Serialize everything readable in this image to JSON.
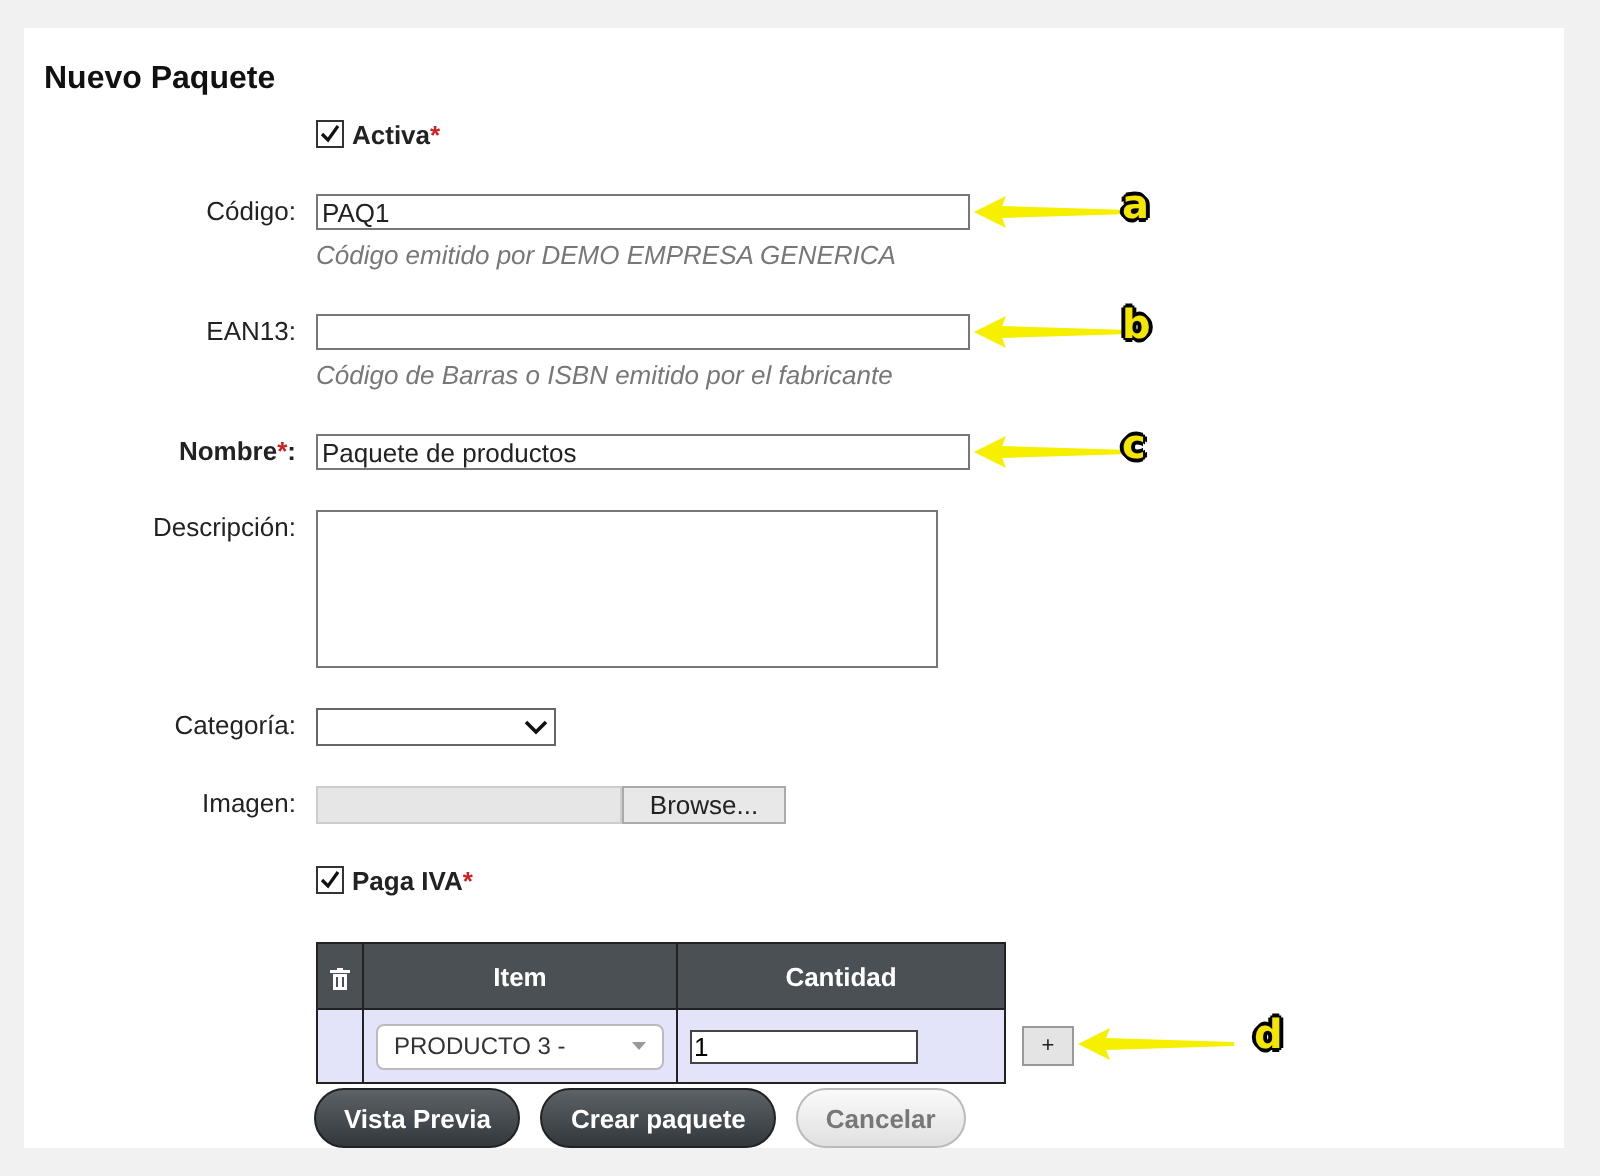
{
  "title": "Nuevo Paquete",
  "fields": [
    {
      "kind": "checkbox",
      "label": "Activa",
      "required_mark": "*",
      "checked": true
    },
    {
      "kind": "text",
      "label": "Código",
      "suffix": ":",
      "value": "PAQ1",
      "hint": "Código emitido por DEMO EMPRESA GENERICA",
      "callout": "a"
    },
    {
      "kind": "text",
      "label": "EAN13",
      "suffix": ":",
      "hint": "Código de Barras o ISBN emitido por el fabricante",
      "callout": "b"
    },
    {
      "kind": "text",
      "label": "Nombre",
      "required_mark": "*",
      "suffix": ":",
      "bold": true,
      "value": "Paquete de productos",
      "callout": "c"
    },
    {
      "kind": "textarea",
      "label": "Descripción",
      "suffix": ":"
    },
    {
      "kind": "select",
      "label": "Categoría",
      "suffix": ":"
    },
    {
      "kind": "file",
      "label": "Imagen",
      "suffix": ":",
      "button": "Browse..."
    },
    {
      "kind": "checkbox",
      "label": "Paga IVA",
      "required_mark": "*",
      "checked": true
    }
  ],
  "table": {
    "columns": [
      {
        "kind": "delete"
      },
      {
        "kind": "text",
        "label": "Item"
      },
      {
        "kind": "text",
        "label": "Cantidad"
      }
    ],
    "rows": [
      {
        "item": "PRODUCTO 3 -",
        "quantity": "1"
      }
    ],
    "add_button": "+",
    "callout": "d"
  },
  "buttons": [
    {
      "label": "Vista Previa",
      "disabled": false
    },
    {
      "label": "Crear paquete",
      "disabled": false
    },
    {
      "label": "Cancelar",
      "disabled": true
    }
  ]
}
